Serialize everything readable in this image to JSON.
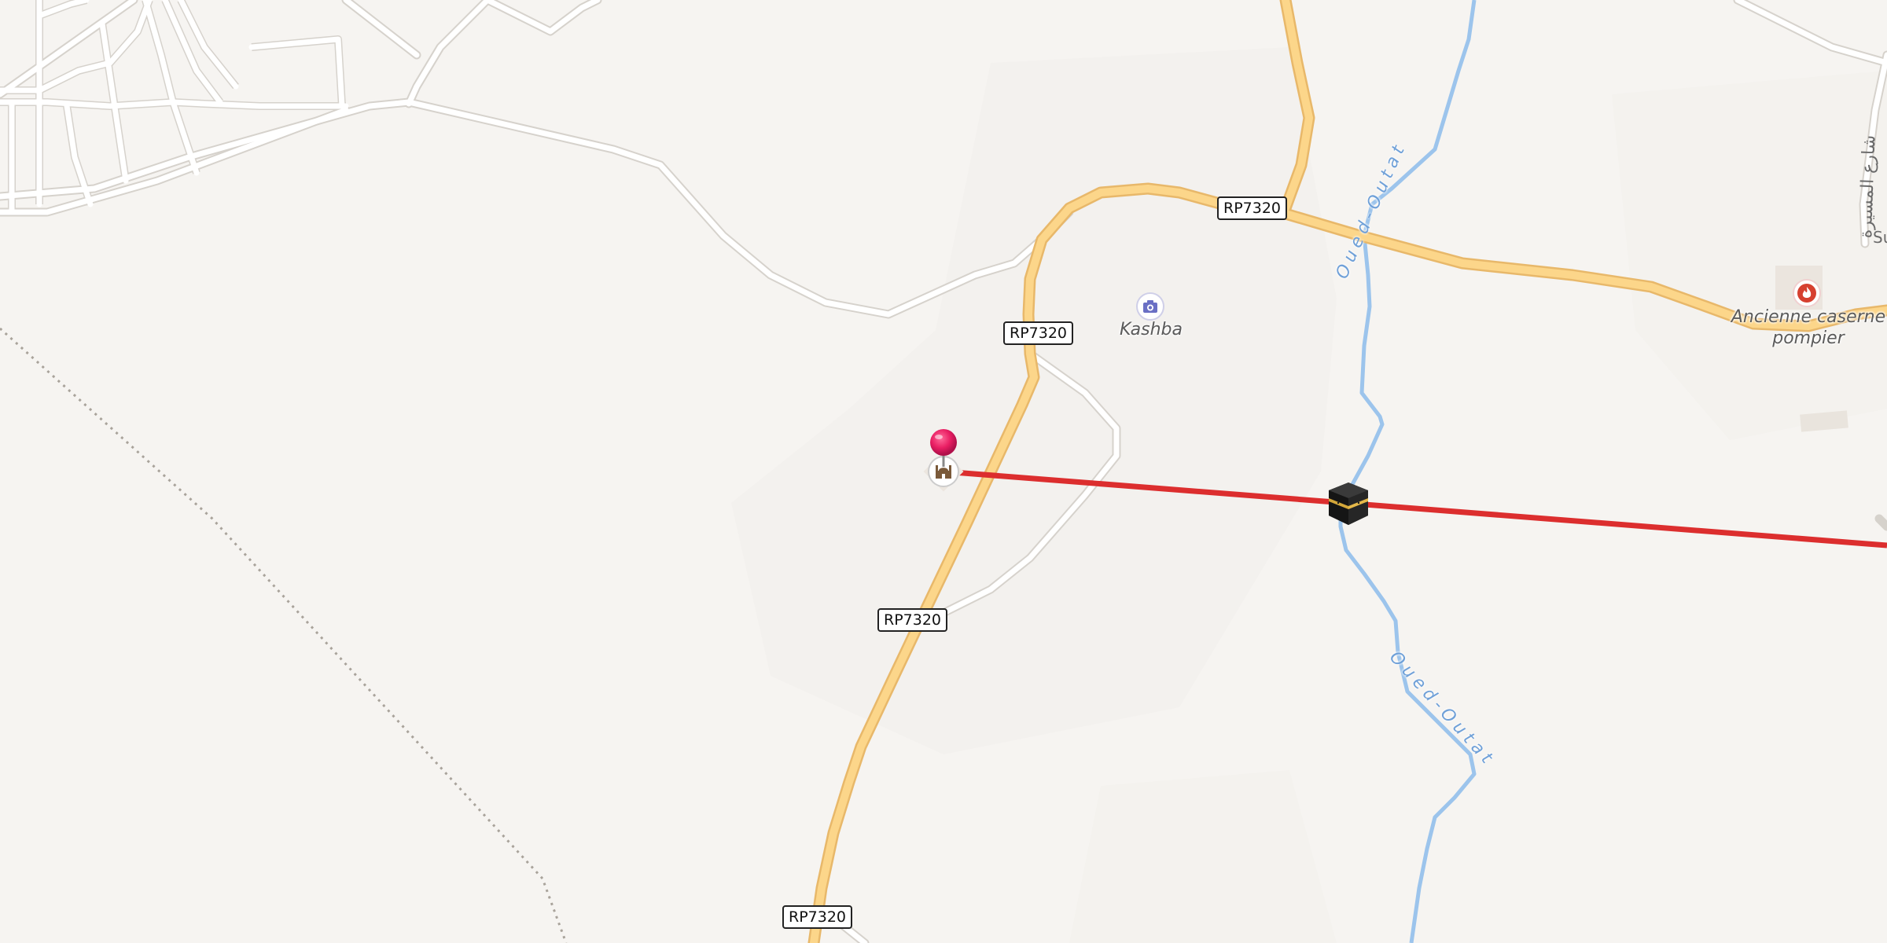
{
  "map": {
    "road_shields": [
      {
        "id": "shield-1",
        "label": "RP7320"
      },
      {
        "id": "shield-2",
        "label": "RP7320"
      },
      {
        "id": "shield-3",
        "label": "RP7320"
      },
      {
        "id": "shield-4",
        "label": "RP7320"
      }
    ],
    "pois": {
      "kashba": {
        "label": "Kashba",
        "icon": "camera-icon"
      },
      "fire_station": {
        "label_line1": "Ancienne caserne",
        "label_line2": "pompier",
        "icon": "fire-icon"
      },
      "mosque": {
        "icon": "mosque-icon"
      },
      "kaaba": {
        "icon": "kaaba-icon"
      },
      "pin": {
        "icon": "location-pin-icon"
      }
    },
    "river": {
      "label": "Oued-Outat"
    },
    "street_label": {
      "text": "شارع المسيرة",
      "partial": "Su"
    },
    "colors": {
      "background": "#f6f4f1",
      "major_road": "#fcd68a",
      "major_road_casing": "#e8b86a",
      "minor_road": "#ffffff",
      "minor_road_casing": "#d8d4cf",
      "river": "#9cc4ec",
      "qibla_line": "#dc2e2e",
      "pin": "#e91e63"
    }
  }
}
